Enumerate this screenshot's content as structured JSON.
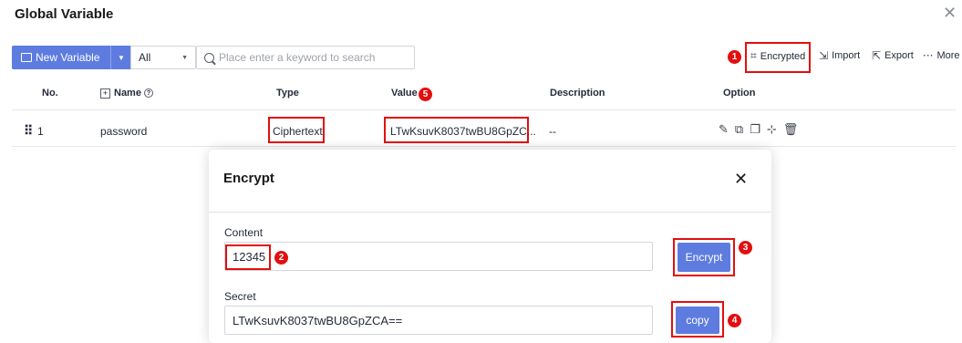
{
  "page": {
    "title": "Global Variable",
    "close_icon": "close-icon"
  },
  "toolbar": {
    "new_variable": "New Variable",
    "filter_value": "All",
    "search_placeholder": "Place enter a keyword to search",
    "encrypted": "Encrypted",
    "import": "Import",
    "export": "Export",
    "more": "More"
  },
  "table": {
    "headers": {
      "no": "No.",
      "name": "Name",
      "type": "Type",
      "value": "Value",
      "description": "Description",
      "option": "Option"
    },
    "rows": [
      {
        "no": "1",
        "name": "password",
        "type": "Ciphertext",
        "value": "LTwKsuvK8037twBU8GpZC...",
        "description": "--"
      }
    ]
  },
  "dialog": {
    "title": "Encrypt",
    "content_label": "Content",
    "content_value": "12345",
    "encrypt_button": "Encrypt",
    "secret_label": "Secret",
    "secret_value": "LTwKsuvK8037twBU8GpZCA==",
    "copy_button": "copy"
  },
  "annotations": {
    "b1": "1",
    "b2": "2",
    "b3": "3",
    "b4": "4",
    "b5": "5"
  },
  "colors": {
    "primary": "#5e7ce0",
    "highlight": "#e40e0e"
  }
}
